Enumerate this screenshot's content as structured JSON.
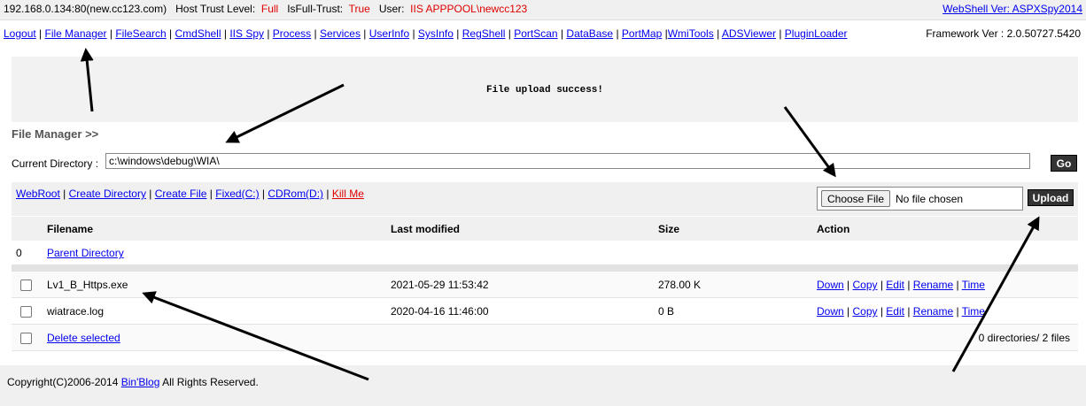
{
  "topbar": {
    "host": "192.168.0.134:80(new.cc123.com)",
    "trust_label": "Host Trust Level:",
    "trust_value": "Full",
    "fulltrust_label": "IsFull-Trust:",
    "fulltrust_value": "True",
    "user_label": "User:",
    "user_value": "IIS APPPOOL\\newcc123",
    "version_link": "WebShell Ver: ASPXSpy2014"
  },
  "menu": {
    "items": [
      "Logout",
      "File Manager",
      "FileSearch",
      "CmdShell",
      "IIS Spy",
      "Process",
      "Services",
      "UserInfo",
      "SysInfo",
      "RegShell",
      "PortScan",
      "DataBase",
      "PortMap",
      "WmiTools",
      "ADSViewer",
      "PluginLoader"
    ],
    "framework": "Framework Ver : 2.0.50727.5420"
  },
  "message": "File upload success!",
  "file_manager": {
    "title": "File Manager >>",
    "current_dir_label": "Current Directory :",
    "current_dir_value": "c:\\windows\\debug\\WIA\\",
    "go_label": "Go"
  },
  "tools": {
    "webroot": "WebRoot",
    "create_directory": "Create Directory",
    "create_file": "Create File",
    "fixed": "Fixed(C:)",
    "cdrom": "CDRom(D:)",
    "kill_me": "Kill Me",
    "choose_file": "Choose File",
    "no_file": "No file chosen",
    "upload": "Upload"
  },
  "table": {
    "headers": {
      "filename": "Filename",
      "modified": "Last modified",
      "size": "Size",
      "action": "Action"
    },
    "parent": {
      "index": "0",
      "label": "Parent Directory"
    },
    "rows": [
      {
        "name": "Lv1_B_Https.exe",
        "modified": "2021-05-29 11:53:42",
        "size": "278.00 K"
      },
      {
        "name": "wiatrace.log",
        "modified": "2020-04-16 11:46:00",
        "size": "0 B"
      }
    ],
    "actions": [
      "Down",
      "Copy",
      "Edit",
      "Rename",
      "Time"
    ],
    "delete_selected": "Delete selected",
    "summary": "0 directories/ 2 files"
  },
  "footer": {
    "prefix": "Copyright(C)2006-2014",
    "link": "Bin'Blog",
    "suffix": "All Rights Reserved."
  }
}
